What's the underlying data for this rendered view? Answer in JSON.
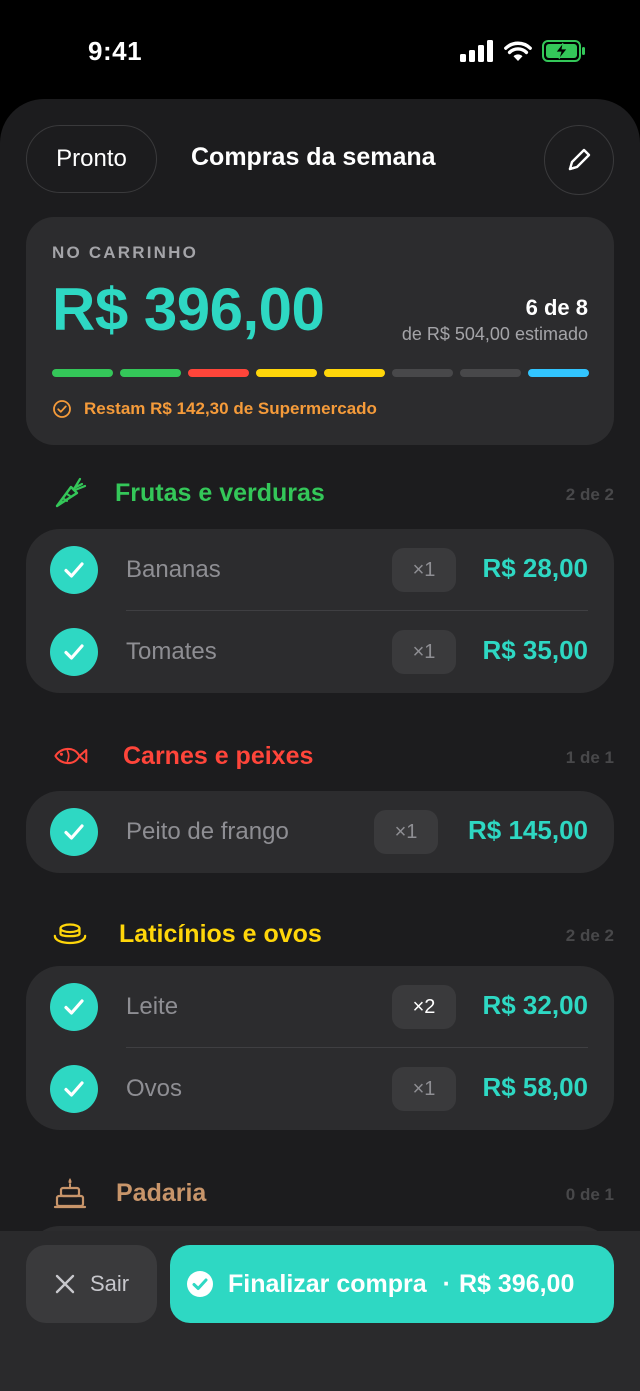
{
  "status_bar": {
    "time": "9:41"
  },
  "nav": {
    "left_button": "Pronto",
    "title": "Compras da semana"
  },
  "summary": {
    "label": "NO CARRINHO",
    "total": "R$ 396,00",
    "count": "6 de 8",
    "estimate": "de R$ 504,00 estimado",
    "progress_colors": [
      "#34c759",
      "#34c759",
      "#ff453a",
      "#ffd60a",
      "#ffd60a",
      "#48484a",
      "#48484a",
      "#32c5ff"
    ],
    "remaining": "Restam R$ 142,30 de Supermercado"
  },
  "sections": [
    {
      "title": "Frutas e verduras",
      "count": "2 de 2",
      "color": "#34c759",
      "icon": "carrot-icon",
      "items": [
        {
          "name": "Bananas",
          "qty": "×1",
          "price": "R$ 28,00",
          "checked": true
        },
        {
          "name": "Tomates",
          "qty": "×1",
          "price": "R$ 35,00",
          "checked": true
        }
      ]
    },
    {
      "title": "Carnes e peixes",
      "count": "1 de 1",
      "color": "#ff453a",
      "icon": "fish-icon",
      "items": [
        {
          "name": "Peito de frango",
          "qty": "×1",
          "price": "R$ 145,00",
          "checked": true
        }
      ]
    },
    {
      "title": "Laticínios e ovos",
      "count": "2 de 2",
      "color": "#ffd60a",
      "icon": "cheese-icon",
      "items": [
        {
          "name": "Leite",
          "qty": "×2",
          "price": "R$ 32,00",
          "checked": true
        },
        {
          "name": "Ovos",
          "qty": "×1",
          "price": "R$ 58,00",
          "checked": true
        }
      ]
    },
    {
      "title": "Padaria",
      "count": "0 de 1",
      "color": "#c8956a",
      "icon": "cake-icon",
      "items": []
    }
  ],
  "bottom_bar": {
    "exit_label": "Sair",
    "finish_label": "Finalizar compra",
    "finish_separator": "·",
    "finish_total": "R$ 396,00"
  },
  "colors": {
    "accent": "#2ed8c3",
    "warning": "#f59b3a",
    "background": "#1c1c1e",
    "card": "#2c2c2e"
  }
}
